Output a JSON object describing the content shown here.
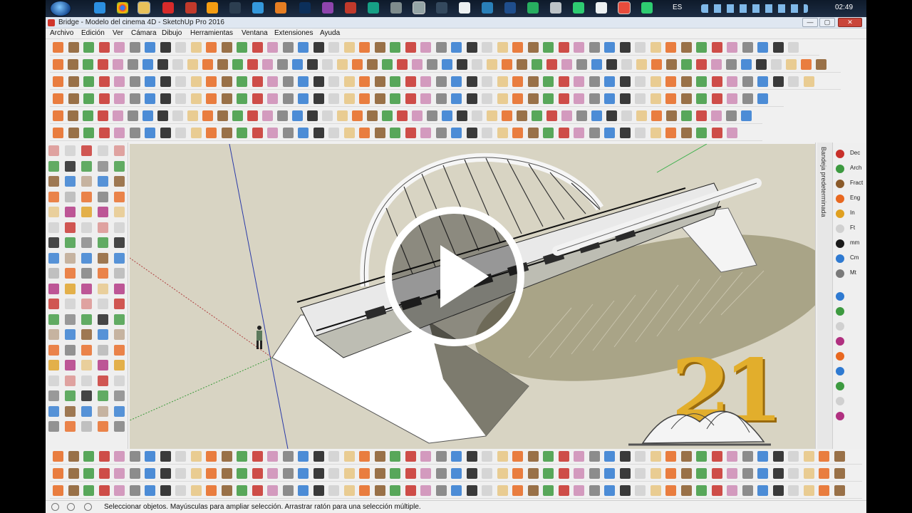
{
  "taskbar": {
    "language": "ES",
    "clock": "02:49"
  },
  "window": {
    "title": "Bridge - Modelo del cinema 4D - SketchUp Pro 2016",
    "minimize_label": "—",
    "maximize_label": "▢",
    "close_label": "✕"
  },
  "menu": [
    {
      "label": "Archivo"
    },
    {
      "label": "Edición"
    },
    {
      "label": "Ver"
    },
    {
      "label": "Cámara"
    },
    {
      "label": "Dibujo"
    },
    {
      "label": "Herramientas"
    },
    {
      "label": "Ventana"
    },
    {
      "label": "Extensiones"
    },
    {
      "label": "Ayuda"
    }
  ],
  "right_tray": {
    "label": "Bandeja predeterminada",
    "units": [
      "Dec",
      "Arch",
      "Fract",
      "Eng",
      "In",
      "Ft",
      "mm",
      "Cm",
      "Mt"
    ]
  },
  "overlay": {
    "play_icon": "play-icon",
    "badge_digits": "21"
  },
  "status": {
    "text": "Seleccionar objetos. Mayúsculas para ampliar selección. Arrastrar ratón para una selección múltiple."
  },
  "colors": {
    "viewport_bg": "#d8d4c3",
    "accent_red": "#c8302a",
    "badge_gold": "#e2ae2c"
  }
}
